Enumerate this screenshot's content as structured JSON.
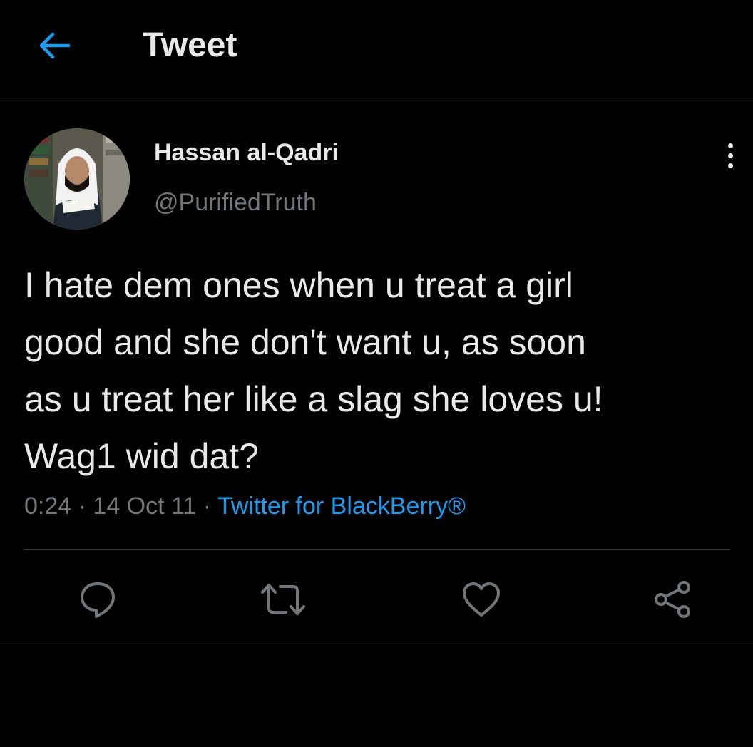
{
  "header": {
    "title": "Tweet",
    "back_icon": "arrow-left-icon",
    "accent_color": "#1d9bf0"
  },
  "tweet": {
    "display_name": "Hassan al-Qadri",
    "handle": "@PurifiedTruth",
    "text": "I hate dem ones when u treat a girl\ngood and she don't want u, as soon\nas u treat her like a slag she loves u!\nWag1 wid dat?",
    "time": "0:24",
    "date": "14 Oct 11",
    "separator": "·",
    "source": "Twitter for BlackBerry®"
  },
  "actions": [
    {
      "icon": "reply-icon"
    },
    {
      "icon": "retweet-icon"
    },
    {
      "icon": "like-icon"
    },
    {
      "icon": "share-icon"
    }
  ],
  "colors": {
    "background": "#000000",
    "text": "#e7e9ea",
    "muted": "#71767b",
    "link": "#1d9bf0",
    "divider": "#2f3336"
  }
}
